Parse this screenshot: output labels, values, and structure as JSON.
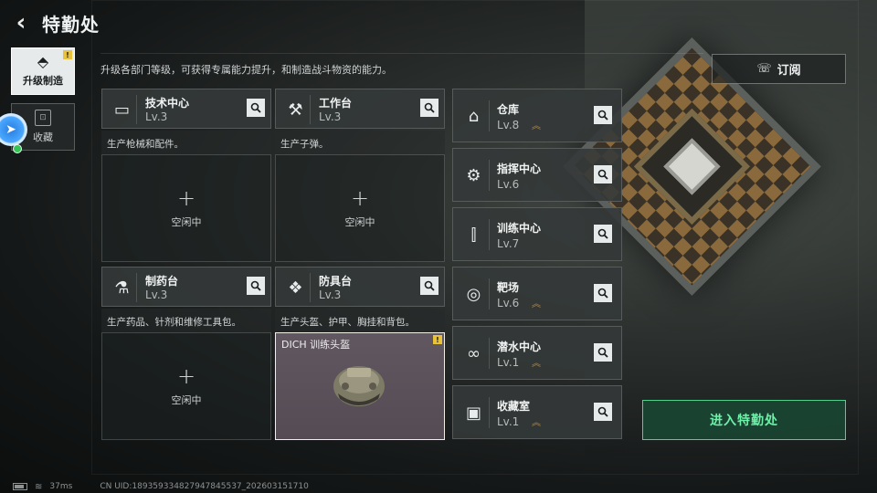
{
  "header": {
    "title": "特勤处"
  },
  "nav": [
    {
      "label": "升级制造",
      "active": true,
      "icon": "upgrade-icon",
      "alert": "!"
    },
    {
      "label": "收藏",
      "active": false,
      "icon": "collection-icon",
      "alert": ""
    }
  ],
  "subtitle": "升级各部门等级，可获得专属能力提升，和制造战斗物资的能力。",
  "subscribe": {
    "label": "订阅"
  },
  "facilities": [
    {
      "name": "技术中心",
      "level": "Lv.3",
      "desc": "生产枪械和配件。",
      "slot": {
        "plus": "+",
        "status": "空闲中"
      },
      "icon": "computer-icon"
    },
    {
      "name": "工作台",
      "level": "Lv.3",
      "desc": "生产子弹。",
      "slot": {
        "plus": "+",
        "status": "空闲中"
      },
      "icon": "tools-icon"
    },
    {
      "name": "制药台",
      "level": "Lv.3",
      "desc": "生产药品、针剂和维修工具包。",
      "slot": {
        "plus": "+",
        "status": "空闲中"
      },
      "icon": "microscope-icon"
    },
    {
      "name": "防具台",
      "level": "Lv.3",
      "desc": "生产头盔、护甲、胸挂和背包。",
      "slot": {
        "item": "DICH 训练头盔",
        "alert": "!"
      },
      "icon": "armor-icon"
    }
  ],
  "rooms": [
    {
      "name": "仓库",
      "level": "Lv.8",
      "upgradable": true,
      "icon": "warehouse-icon"
    },
    {
      "name": "指挥中心",
      "level": "Lv.6",
      "upgradable": false,
      "icon": "chip-icon"
    },
    {
      "name": "训练中心",
      "level": "Lv.7",
      "upgradable": false,
      "icon": "dumbbell-icon"
    },
    {
      "name": "靶场",
      "level": "Lv.6",
      "upgradable": true,
      "icon": "target-icon"
    },
    {
      "name": "潜水中心",
      "level": "Lv.1",
      "upgradable": true,
      "icon": "diving-mask-icon"
    },
    {
      "name": "收藏室",
      "level": "Lv.1",
      "upgradable": true,
      "icon": "display-case-icon"
    }
  ],
  "upgrade_glyph": "︽",
  "enter": {
    "label": "进入特勤处"
  },
  "footer": {
    "ping": "37ms",
    "uid": "CN UID:18935933482794784553​7_202603151710"
  },
  "colors": {
    "accent_green": "#4fd08e",
    "alert_yellow": "#e8c23a",
    "upgrade_gold": "#b08a4a"
  }
}
